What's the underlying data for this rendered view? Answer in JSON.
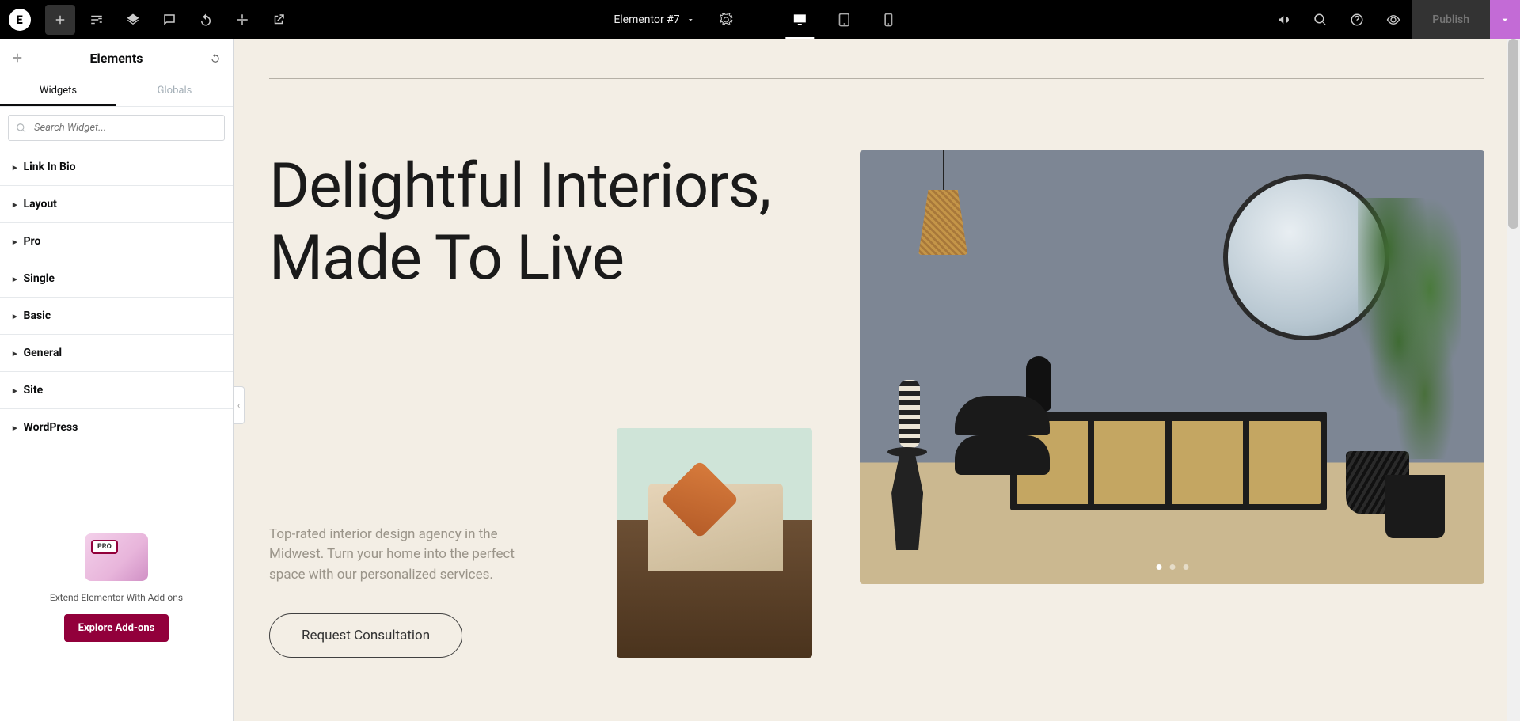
{
  "topbar": {
    "doc_title": "Elementor #7",
    "publish_label": "Publish"
  },
  "panel": {
    "title": "Elements",
    "tabs": {
      "widgets": "Widgets",
      "globals": "Globals"
    },
    "search_placeholder": "Search Widget...",
    "categories": [
      "Link In Bio",
      "Layout",
      "Pro",
      "Single",
      "Basic",
      "General",
      "Site",
      "WordPress"
    ],
    "promo": {
      "text": "Extend Elementor With Add-ons",
      "button": "Explore Add-ons"
    }
  },
  "hero": {
    "title_line1": "Delightful Interiors,",
    "title_line2": "Made To Live",
    "description": "Top-rated interior design agency in the Midwest. Turn your home into the perfect space with our personalized services.",
    "cta": "Request Consultation"
  }
}
